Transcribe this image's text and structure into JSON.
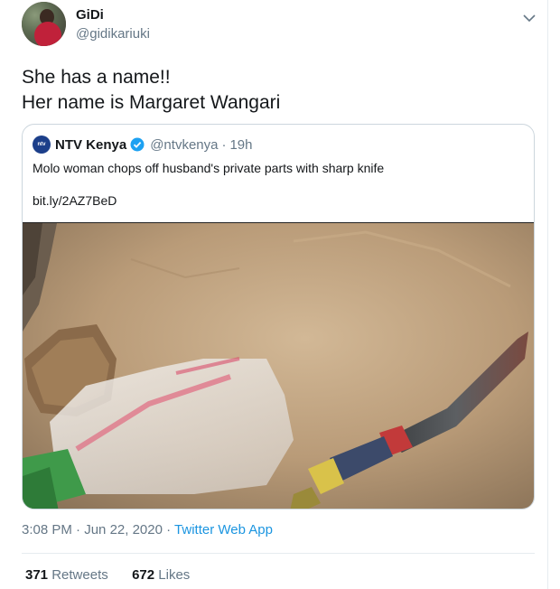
{
  "author": {
    "name": "GiDi",
    "handle": "@gidikariuki"
  },
  "tweet": {
    "line1": "She has a name!!",
    "line2": "Her name is Margaret Wangari"
  },
  "quoted": {
    "avatar_text": "ntv",
    "name": "NTV Kenya",
    "handle": "@ntvkenya",
    "separator": "·",
    "time": "19h",
    "text": "Molo woman chops off husband's private parts with sharp knife",
    "link": "bit.ly/2AZ7BeD"
  },
  "meta": {
    "time": "3:08 PM",
    "separator1": "·",
    "date": "Jun 22, 2020",
    "separator2": "·",
    "app": "Twitter Web App"
  },
  "stats": {
    "retweets_count": "371",
    "retweets_label": "Retweets",
    "likes_count": "672",
    "likes_label": "Likes"
  },
  "icons": {
    "menu": "chevron-down-icon",
    "verified": "verified-badge-icon"
  },
  "colors": {
    "link_blue": "#1b95e0",
    "verified_blue": "#1da1f2",
    "muted": "#657786",
    "border": "#ccd6dd"
  }
}
